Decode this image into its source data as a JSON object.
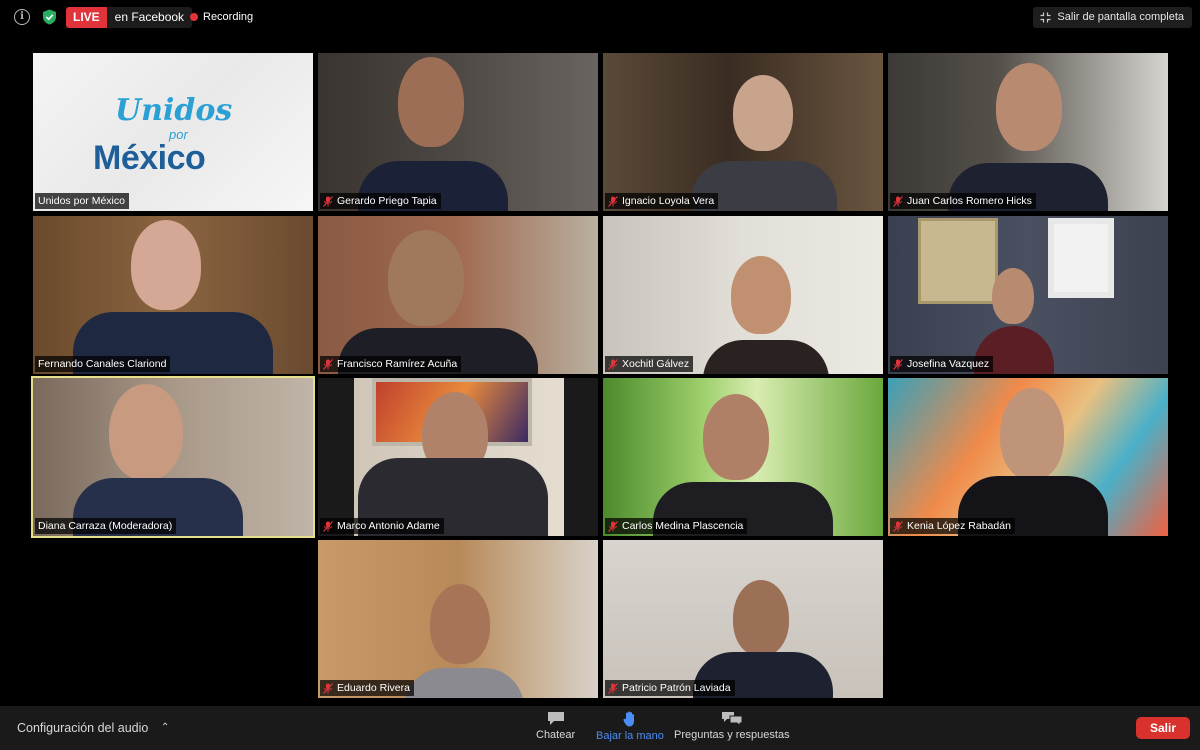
{
  "topbar": {
    "live_badge": "LIVE",
    "live_destination": "en Facebook",
    "recording": "Recording",
    "exit_fullscreen": "Salir de pantalla completa"
  },
  "logo": {
    "line1": "Unidos",
    "line2": "por",
    "line3": "México"
  },
  "participants": [
    {
      "name": "Unidos por México",
      "muted": false
    },
    {
      "name": "Gerardo Priego Tapia",
      "muted": true
    },
    {
      "name": "Ignacio Loyola Vera",
      "muted": true
    },
    {
      "name": "Juan Carlos Romero Hicks",
      "muted": true
    },
    {
      "name": "Fernando Canales Clariond",
      "muted": false
    },
    {
      "name": "Francisco Ramírez Acuña",
      "muted": true
    },
    {
      "name": "Xochitl Gálvez",
      "muted": true
    },
    {
      "name": "Josefina Vazquez",
      "muted": true
    },
    {
      "name": "Diana Carraza (Moderadora)",
      "muted": false
    },
    {
      "name": "Marco Antonio Adame",
      "muted": true
    },
    {
      "name": "Carlos Medina Plascencia",
      "muted": true
    },
    {
      "name": "Kenia López Rabadán",
      "muted": true
    },
    {
      "name": "Eduardo Rivera",
      "muted": true
    },
    {
      "name": "Patricio Patrón Laviada",
      "muted": true
    }
  ],
  "toolbar": {
    "audio_settings": "Configuración del audio",
    "chat": "Chatear",
    "lower_hand": "Bajar la mano",
    "qa": "Preguntas y respuestas",
    "exit": "Salir"
  },
  "colors": {
    "live_red": "#e0333a",
    "active_speaker_border": "#e6e08a",
    "hand_blue": "#4b8df5",
    "exit_red": "#d9312b"
  }
}
